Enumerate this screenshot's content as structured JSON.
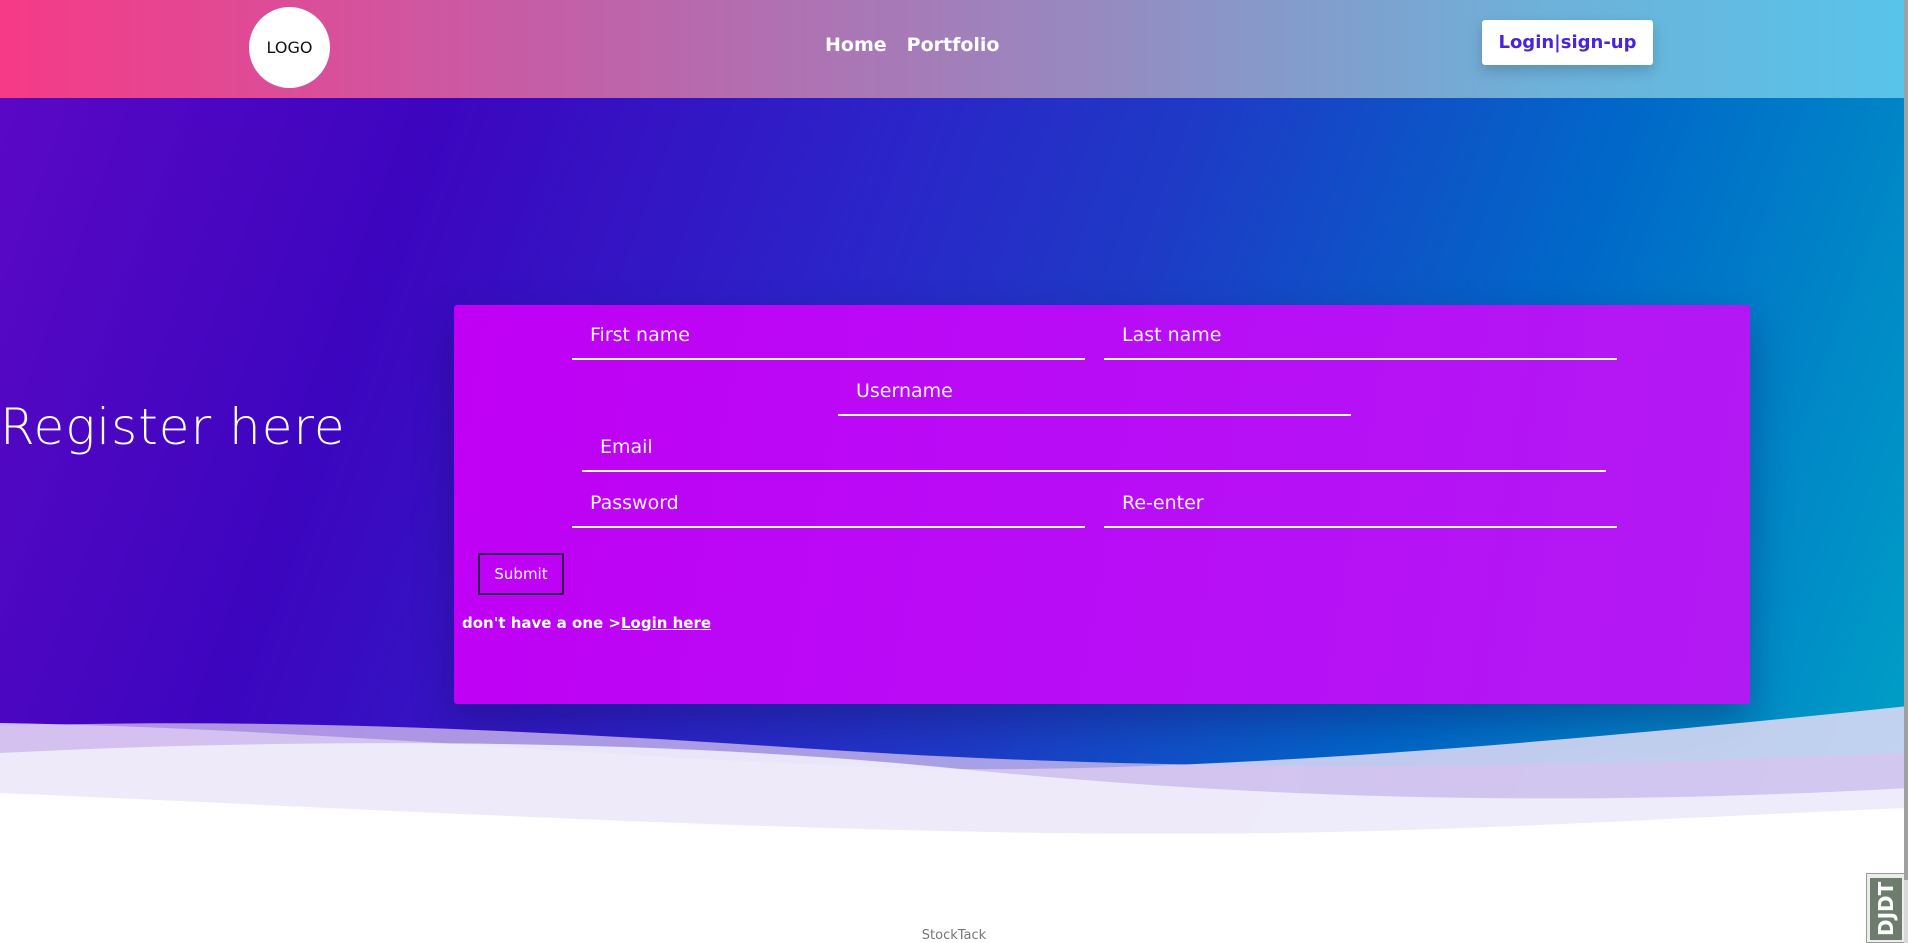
{
  "header": {
    "logo_text": "LOGO",
    "nav": [
      {
        "label": "Home"
      },
      {
        "label": "Portfolio"
      }
    ],
    "login_signup_label": "Login|sign-up"
  },
  "hero": {
    "title": "Register here"
  },
  "form": {
    "first_name_placeholder": "First name",
    "last_name_placeholder": "Last name",
    "username_placeholder": "Username",
    "email_placeholder": "Email",
    "password_placeholder": "Password",
    "reenter_placeholder": "Re-enter",
    "submit_label": "Submit",
    "hint_text": "don't have a one >",
    "hint_link": "Login here"
  },
  "footer": {
    "text": "StockTack"
  },
  "debug_toolbar": {
    "label": "DJDT"
  },
  "colors": {
    "card_background": "#bb07f6",
    "header_gradient_start": "#f63a87",
    "header_gradient_end": "#58c4ea",
    "hero_gradient_start": "#5a08c4",
    "hero_gradient_end": "#00a4c6",
    "login_button_text": "#4a24d6"
  }
}
